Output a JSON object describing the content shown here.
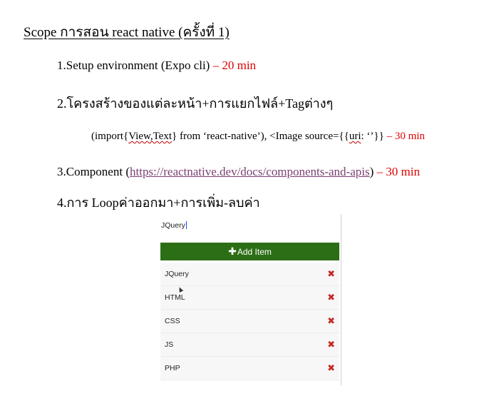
{
  "doc": {
    "title": "Scope การสอน react native (ครั้งที่ 1)",
    "item1": {
      "text": "1.Setup environment (Expo cli) ",
      "time": "– 20 min"
    },
    "item2": {
      "text": "2.โครงสร้างของแต่ละหน้า+การแยกไฟล์+Tagต่างๆ"
    },
    "item2_detail": {
      "pre": "(import{",
      "view_text": "View,Text",
      "mid": "} from ‘react-native’), <Image source={{",
      "uri": "uri",
      "post": ": ‘’}} ",
      "time": "– 30 min"
    },
    "item3": {
      "pre": "3.Component (",
      "link": "https://reactnative.dev/docs/components-and-apis",
      "post": ") ",
      "time": "– 30 min"
    },
    "item4": {
      "text": "4.การ Loopค่าออกมา+การเพิ่ม-ลบค่า"
    }
  },
  "app": {
    "input_value": "JQuery",
    "add_button": {
      "icon": "plus-icon",
      "label": "Add Item"
    },
    "delete_icon": "close-icon",
    "delete_glyph": "✖",
    "items": [
      "JQuery",
      "HTML",
      "CSS",
      "JS",
      "PHP"
    ],
    "colors": {
      "button": "#2c6e16",
      "delete": "#c62828",
      "time": "#e00000",
      "link": "#7b3f72"
    }
  }
}
